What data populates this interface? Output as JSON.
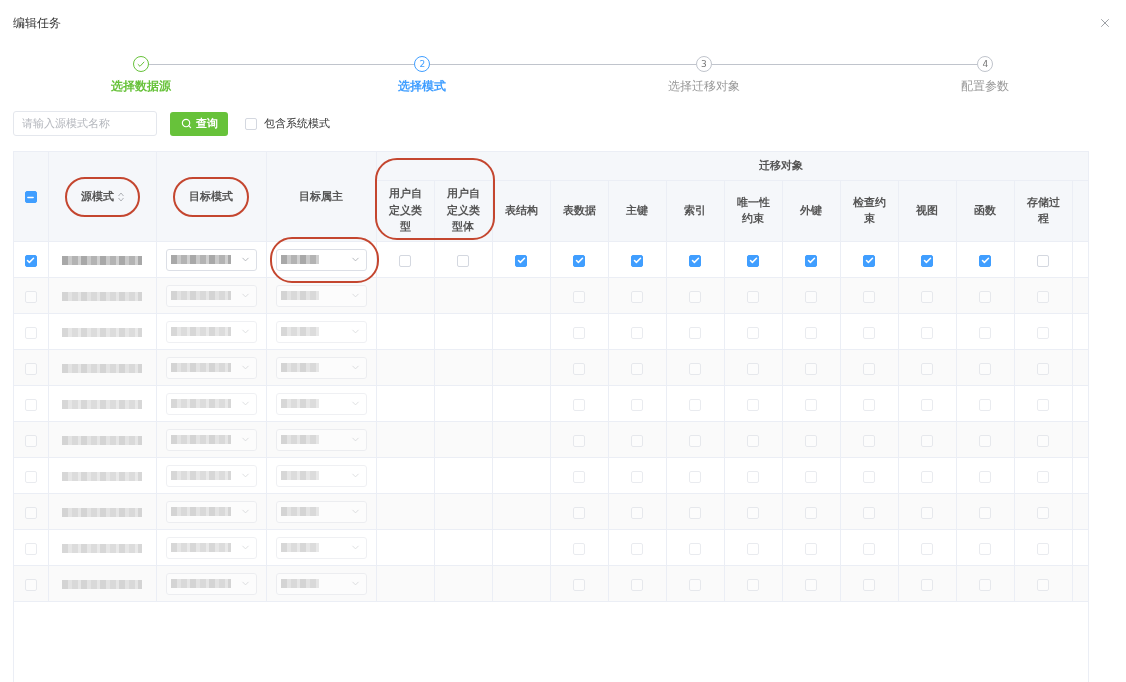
{
  "dialog": {
    "title": "编辑任务"
  },
  "steps": [
    {
      "label": "选择数据源",
      "done": true,
      "active": false
    },
    {
      "number": "2",
      "label": "选择模式",
      "done": false,
      "active": true
    },
    {
      "number": "3",
      "label": "选择迁移对象",
      "done": false,
      "active": false
    },
    {
      "number": "4",
      "label": "配置参数",
      "done": false,
      "active": false
    }
  ],
  "toolbar": {
    "search": {
      "placeholder": "请输入源模式名称"
    },
    "query_button": "查询",
    "include_system": {
      "label": "包含系统模式",
      "checked": false
    }
  },
  "table": {
    "select_all": {
      "indeterminate": true
    },
    "columns": [
      {
        "label": "源模式",
        "sortable": true,
        "highlighted": true
      },
      {
        "label": "目标模式",
        "sortable": false,
        "highlighted": true
      },
      {
        "label": "目标属主",
        "sortable": false,
        "highlighted": false
      }
    ],
    "object_group": {
      "label": "迁移对象",
      "columns": [
        {
          "label": "用户自定义类型",
          "highlighted": true
        },
        {
          "label": "用户自定义类型体",
          "highlighted": true
        },
        {
          "label": "表结构",
          "highlighted": false
        },
        {
          "label": "表数据",
          "highlighted": false
        },
        {
          "label": "主键",
          "highlighted": false
        },
        {
          "label": "索引",
          "highlighted": false
        },
        {
          "label": "唯一性约束",
          "highlighted": false
        },
        {
          "label": "外键",
          "highlighted": false
        },
        {
          "label": "检查约束",
          "highlighted": false
        },
        {
          "label": "视图",
          "highlighted": false
        },
        {
          "label": "函数",
          "highlighted": false
        },
        {
          "label": "存储过程",
          "highlighted": false
        }
      ]
    },
    "rows": [
      {
        "selected": true,
        "redacted": true,
        "dimmed": false,
        "owner_highlighted": true,
        "objects": [
          {
            "kind": "checkbox",
            "checked": false
          },
          {
            "kind": "checkbox",
            "checked": false
          },
          {
            "kind": "checkbox",
            "checked": true
          },
          {
            "kind": "checkbox",
            "checked": true
          },
          {
            "kind": "checkbox",
            "checked": true
          },
          {
            "kind": "checkbox",
            "checked": true
          },
          {
            "kind": "checkbox",
            "checked": true
          },
          {
            "kind": "checkbox",
            "checked": true
          },
          {
            "kind": "checkbox",
            "checked": true
          },
          {
            "kind": "checkbox",
            "checked": true
          },
          {
            "kind": "checkbox",
            "checked": true
          },
          {
            "kind": "checkbox",
            "checked": false
          }
        ]
      },
      {
        "selected": false,
        "redacted": true,
        "dimmed": true,
        "owner_highlighted": false,
        "objects": [
          {
            "kind": "erased"
          },
          {
            "kind": "erased"
          },
          {
            "kind": "erased"
          },
          {
            "kind": "checkbox",
            "checked": false
          },
          {
            "kind": "checkbox",
            "checked": false
          },
          {
            "kind": "checkbox",
            "checked": false
          },
          {
            "kind": "checkbox",
            "checked": false
          },
          {
            "kind": "checkbox",
            "checked": false
          },
          {
            "kind": "checkbox",
            "checked": false
          },
          {
            "kind": "checkbox",
            "checked": false
          },
          {
            "kind": "checkbox",
            "checked": false
          },
          {
            "kind": "checkbox",
            "checked": false
          }
        ]
      },
      {
        "selected": false,
        "redacted": true,
        "dimmed": true,
        "owner_highlighted": false,
        "objects": [
          {
            "kind": "erased"
          },
          {
            "kind": "erased"
          },
          {
            "kind": "erased"
          },
          {
            "kind": "checkbox",
            "checked": false
          },
          {
            "kind": "checkbox",
            "checked": false
          },
          {
            "kind": "checkbox",
            "checked": false
          },
          {
            "kind": "checkbox",
            "checked": false
          },
          {
            "kind": "checkbox",
            "checked": false
          },
          {
            "kind": "checkbox",
            "checked": false
          },
          {
            "kind": "checkbox",
            "checked": false
          },
          {
            "kind": "checkbox",
            "checked": false
          },
          {
            "kind": "checkbox",
            "checked": false
          }
        ]
      },
      {
        "selected": false,
        "redacted": true,
        "dimmed": true,
        "owner_highlighted": false,
        "objects": [
          {
            "kind": "erased"
          },
          {
            "kind": "erased"
          },
          {
            "kind": "erased"
          },
          {
            "kind": "checkbox",
            "checked": false
          },
          {
            "kind": "checkbox",
            "checked": false
          },
          {
            "kind": "checkbox",
            "checked": false
          },
          {
            "kind": "checkbox",
            "checked": false
          },
          {
            "kind": "checkbox",
            "checked": false
          },
          {
            "kind": "checkbox",
            "checked": false
          },
          {
            "kind": "checkbox",
            "checked": false
          },
          {
            "kind": "checkbox",
            "checked": false
          },
          {
            "kind": "checkbox",
            "checked": false
          }
        ]
      },
      {
        "selected": false,
        "redacted": true,
        "dimmed": true,
        "owner_highlighted": false,
        "objects": [
          {
            "kind": "erased"
          },
          {
            "kind": "erased"
          },
          {
            "kind": "erased"
          },
          {
            "kind": "checkbox",
            "checked": false
          },
          {
            "kind": "checkbox",
            "checked": false
          },
          {
            "kind": "checkbox",
            "checked": false
          },
          {
            "kind": "checkbox",
            "checked": false
          },
          {
            "kind": "checkbox",
            "checked": false
          },
          {
            "kind": "checkbox",
            "checked": false
          },
          {
            "kind": "checkbox",
            "checked": false
          },
          {
            "kind": "checkbox",
            "checked": false
          },
          {
            "kind": "checkbox",
            "checked": false
          }
        ]
      },
      {
        "selected": false,
        "redacted": true,
        "dimmed": true,
        "owner_highlighted": false,
        "objects": [
          {
            "kind": "erased"
          },
          {
            "kind": "erased"
          },
          {
            "kind": "erased"
          },
          {
            "kind": "checkbox",
            "checked": false
          },
          {
            "kind": "checkbox",
            "checked": false
          },
          {
            "kind": "checkbox",
            "checked": false
          },
          {
            "kind": "checkbox",
            "checked": false
          },
          {
            "kind": "checkbox",
            "checked": false
          },
          {
            "kind": "checkbox",
            "checked": false
          },
          {
            "kind": "checkbox",
            "checked": false
          },
          {
            "kind": "checkbox",
            "checked": false
          },
          {
            "kind": "checkbox",
            "checked": false
          }
        ]
      },
      {
        "selected": false,
        "redacted": true,
        "dimmed": true,
        "owner_highlighted": false,
        "objects": [
          {
            "kind": "erased"
          },
          {
            "kind": "erased"
          },
          {
            "kind": "erased"
          },
          {
            "kind": "checkbox",
            "checked": false
          },
          {
            "kind": "checkbox",
            "checked": false
          },
          {
            "kind": "checkbox",
            "checked": false
          },
          {
            "kind": "checkbox",
            "checked": false
          },
          {
            "kind": "checkbox",
            "checked": false
          },
          {
            "kind": "checkbox",
            "checked": false
          },
          {
            "kind": "checkbox",
            "checked": false
          },
          {
            "kind": "checkbox",
            "checked": false
          },
          {
            "kind": "checkbox",
            "checked": false
          }
        ]
      },
      {
        "selected": false,
        "redacted": true,
        "dimmed": true,
        "owner_highlighted": false,
        "objects": [
          {
            "kind": "erased"
          },
          {
            "kind": "erased"
          },
          {
            "kind": "erased"
          },
          {
            "kind": "checkbox",
            "checked": false
          },
          {
            "kind": "checkbox",
            "checked": false
          },
          {
            "kind": "checkbox",
            "checked": false
          },
          {
            "kind": "checkbox",
            "checked": false
          },
          {
            "kind": "checkbox",
            "checked": false
          },
          {
            "kind": "checkbox",
            "checked": false
          },
          {
            "kind": "checkbox",
            "checked": false
          },
          {
            "kind": "checkbox",
            "checked": false
          },
          {
            "kind": "checkbox",
            "checked": false
          }
        ]
      },
      {
        "selected": false,
        "redacted": true,
        "dimmed": true,
        "owner_highlighted": false,
        "objects": [
          {
            "kind": "erased"
          },
          {
            "kind": "erased"
          },
          {
            "kind": "erased"
          },
          {
            "kind": "checkbox",
            "checked": false
          },
          {
            "kind": "checkbox",
            "checked": false
          },
          {
            "kind": "checkbox",
            "checked": false
          },
          {
            "kind": "checkbox",
            "checked": false
          },
          {
            "kind": "checkbox",
            "checked": false
          },
          {
            "kind": "checkbox",
            "checked": false
          },
          {
            "kind": "checkbox",
            "checked": false
          },
          {
            "kind": "checkbox",
            "checked": false
          },
          {
            "kind": "checkbox",
            "checked": false
          }
        ]
      },
      {
        "selected": false,
        "redacted": true,
        "dimmed": true,
        "owner_highlighted": false,
        "objects": [
          {
            "kind": "erased"
          },
          {
            "kind": "erased"
          },
          {
            "kind": "erased"
          },
          {
            "kind": "checkbox",
            "checked": false
          },
          {
            "kind": "checkbox",
            "checked": false
          },
          {
            "kind": "checkbox",
            "checked": false
          },
          {
            "kind": "checkbox",
            "checked": false
          },
          {
            "kind": "checkbox",
            "checked": false
          },
          {
            "kind": "checkbox",
            "checked": false
          },
          {
            "kind": "checkbox",
            "checked": false
          },
          {
            "kind": "checkbox",
            "checked": false
          },
          {
            "kind": "checkbox",
            "checked": false
          }
        ]
      }
    ]
  }
}
